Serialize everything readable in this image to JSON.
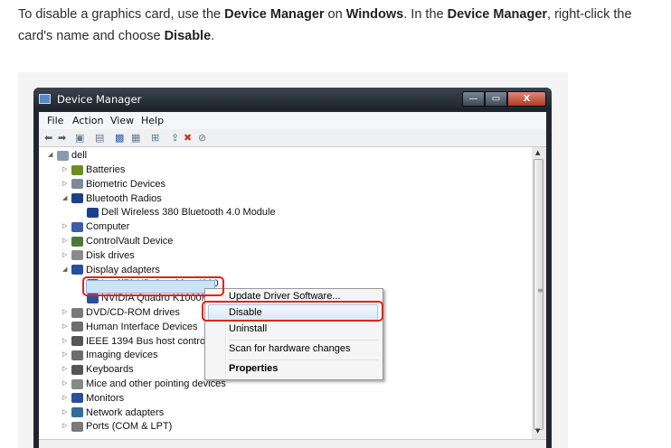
{
  "intro": {
    "t1": "To disable a graphics card, use the ",
    "b1": "Device Manager",
    "t2": " on ",
    "b2": "Windows",
    "t3": ". In the ",
    "b3": "Device Manager",
    "t4": ", right-click the card's name and choose ",
    "b4": "Disable",
    "t5": "."
  },
  "window": {
    "title": "Device Manager",
    "buttons": {
      "minimize": "—",
      "maximize": "▭",
      "close": "X"
    }
  },
  "menu": [
    "File",
    "Action",
    "View",
    "Help"
  ],
  "toolbar_icons": [
    "back-arrow-icon",
    "forward-arrow-icon",
    "properties-icon",
    "tree-view-icon",
    "help-icon",
    "view-icon",
    "scan-icon",
    "update-driver-icon",
    "uninstall-icon",
    "disable-icon"
  ],
  "tree": {
    "root": "dell",
    "items": [
      {
        "label": "Batteries",
        "level": 1,
        "expanded": false
      },
      {
        "label": "Biometric Devices",
        "level": 1,
        "expanded": false
      },
      {
        "label": "Bluetooth Radios",
        "level": 1,
        "expanded": true
      },
      {
        "label": "Dell Wireless 380 Bluetooth 4.0 Module",
        "level": 2
      },
      {
        "label": "Computer",
        "level": 1,
        "expanded": false
      },
      {
        "label": "ControlVault Device",
        "level": 1,
        "expanded": false
      },
      {
        "label": "Disk drives",
        "level": 1,
        "expanded": false
      },
      {
        "label": "Display adapters",
        "level": 1,
        "expanded": true
      },
      {
        "label": "Intel(R) HD Graphics 4000",
        "level": 2,
        "selected": true
      },
      {
        "label": "NVIDIA Quadro K1000M",
        "level": 2
      },
      {
        "label": "DVD/CD-ROM drives",
        "level": 1,
        "expanded": false
      },
      {
        "label": "Human Interface Devices",
        "level": 1,
        "expanded": false
      },
      {
        "label": "IEEE 1394 Bus host controllers",
        "level": 1,
        "expanded": false
      },
      {
        "label": "Imaging devices",
        "level": 1,
        "expanded": false
      },
      {
        "label": "Keyboards",
        "level": 1,
        "expanded": false
      },
      {
        "label": "Mice and other pointing devices",
        "level": 1,
        "expanded": false
      },
      {
        "label": "Monitors",
        "level": 1,
        "expanded": false
      },
      {
        "label": "Network adapters",
        "level": 1,
        "expanded": false
      },
      {
        "label": "Ports (COM & LPT)",
        "level": 1,
        "expanded": false
      }
    ]
  },
  "context_menu": {
    "update": "Update Driver Software...",
    "disable": "Disable",
    "uninstall": "Uninstall",
    "scan": "Scan for hardware changes",
    "properties": "Properties"
  },
  "colors": {
    "highlight_red": "#e2231a",
    "selection": "#cde4f7"
  }
}
